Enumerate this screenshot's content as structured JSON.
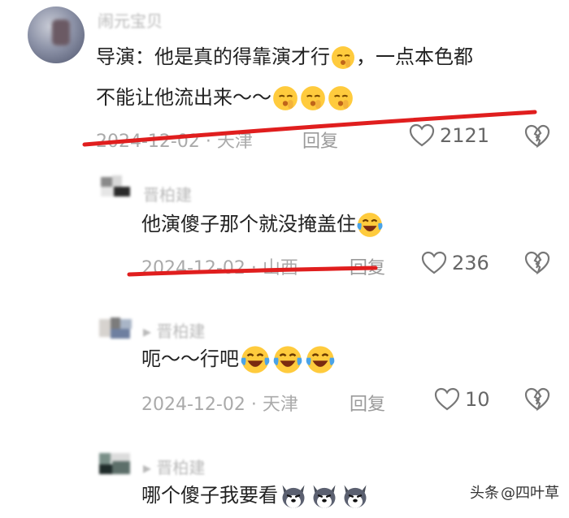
{
  "comments": [
    {
      "username": "闹元宝贝",
      "text_line1": "导演：他是真的得靠演才行",
      "text_line1_end": "，一点本色都",
      "text_line2": "不能让他流出来～～",
      "emoji_line1": "shushing-face-emoji",
      "emoji_line2": "shushing-face-emoji",
      "date": "2024-12-02 · 天津",
      "reply_label": "回复",
      "likes": "2121"
    },
    {
      "username": "晋柏建",
      "text": "他演傻子那个就没掩盖住",
      "emoji": "tears-of-joy-emoji",
      "date": "2024-12-02 · 山西",
      "reply_label": "回复",
      "likes": "236"
    },
    {
      "username": "▸ 晋柏建",
      "text": "呃～～行吧",
      "emoji": "tears-of-joy-emoji",
      "date": "2024-12-02 · 天津",
      "reply_label": "回复",
      "likes": "10"
    },
    {
      "username": "▸ 晋柏建",
      "text": "哪个傻子我要看",
      "emoji": "husky-dog-emoji"
    }
  ],
  "watermark": {
    "platform": "头条",
    "handle": "@四叶草"
  },
  "colors": {
    "annotation_red": "#e01e1e",
    "meta_gray": "#aaaaaa",
    "text": "#222222"
  }
}
